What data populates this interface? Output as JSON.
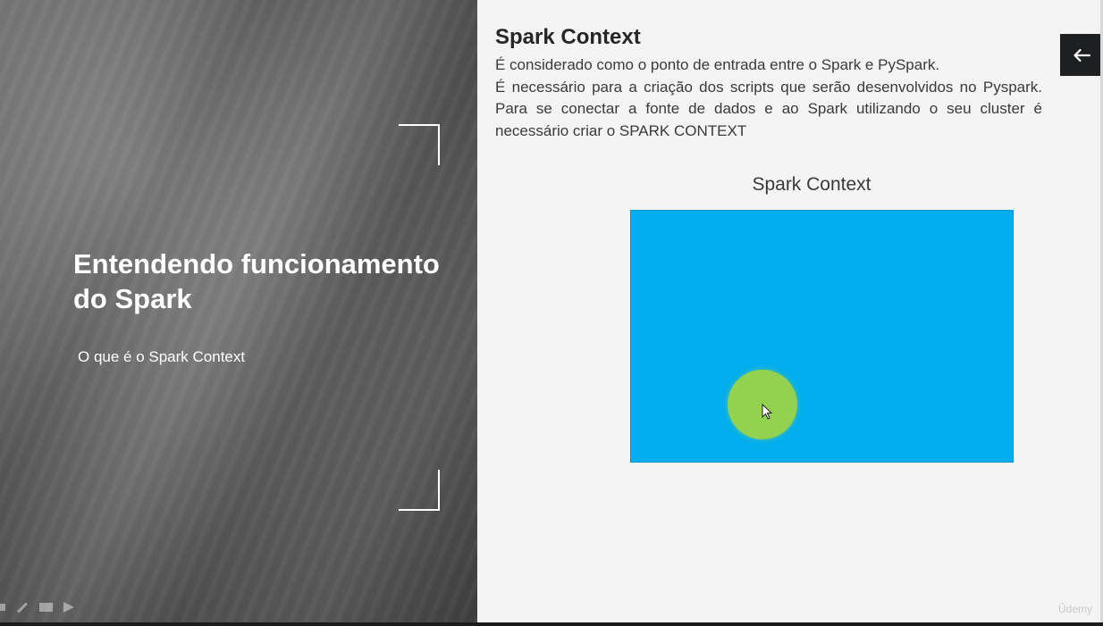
{
  "slide": {
    "section_title": "Entendendo funcionamento do Spark",
    "section_subtitle": "O que é o Spark Context",
    "heading": "Spark Context",
    "paragraph_line1": "É considerado como o ponto de entrada entre o Spark e PySpark.",
    "paragraph_line2": "É necessário para a criação dos scripts que serão desenvolvidos no Pyspark. Para se conectar a fonte de dados e ao Spark utilizando o seu cluster é necessário criar o SPARK CONTEXT",
    "diagram_caption": "Spark Context"
  },
  "player": {
    "watermark": "Ûdemy",
    "back_icon": "arrow-left-icon",
    "toolbar_icons": [
      "previous-icon",
      "pen-icon",
      "screen-icon",
      "next-icon"
    ]
  },
  "colors": {
    "diagram_fill": "#03aeef",
    "highlight": "#93d24f",
    "back_button_bg": "#1d1f20"
  }
}
